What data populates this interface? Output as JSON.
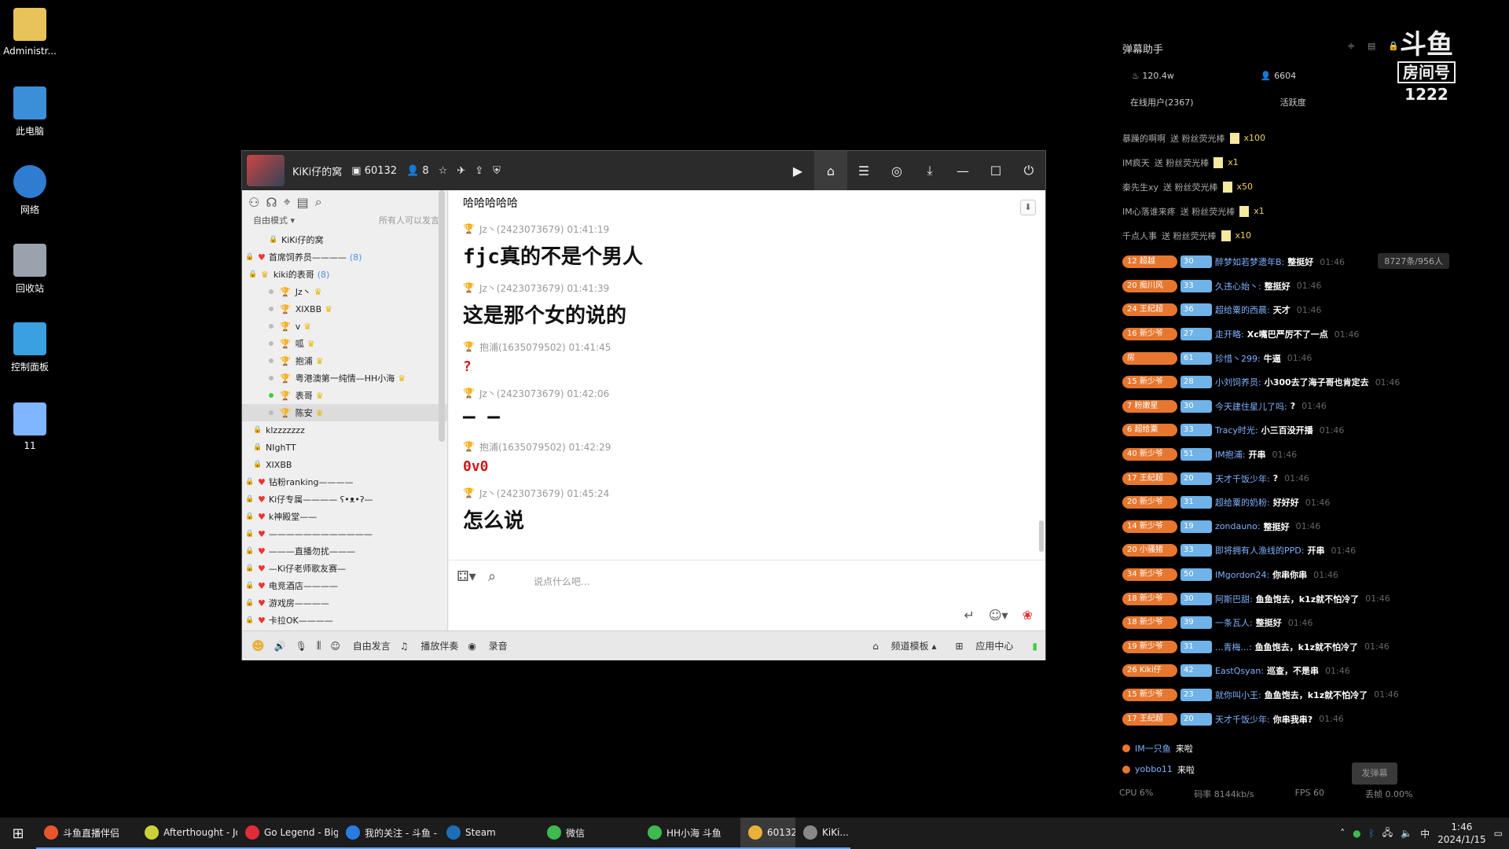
{
  "desktop": {
    "icons": [
      {
        "label": "Administr...",
        "color": "#e8c35a"
      },
      {
        "label": "此电脑",
        "color": "#3b8fd9"
      },
      {
        "label": "网络",
        "color": "#2f7dd1"
      },
      {
        "label": "回收站",
        "color": "#9aa3ad"
      },
      {
        "label": "控制面板",
        "color": "#3aa0e0"
      },
      {
        "label": "11",
        "color": "#7fb6ff"
      }
    ]
  },
  "window": {
    "title": "KiKi仔的窝",
    "channel_id": "60132",
    "members": "8",
    "left": {
      "mode": "自由模式",
      "mode_hint": "所有人可以发言",
      "tree": [
        {
          "label": "KiKi仔的窝",
          "type": "root"
        },
        {
          "label": "首席饲养员————",
          "type": "group",
          "count": "(8)"
        },
        {
          "label": "kiki的表哥",
          "type": "subgroup",
          "count": "(8)"
        },
        {
          "label": "Jz丶",
          "type": "user",
          "online": false
        },
        {
          "label": "XIXBB",
          "type": "user",
          "online": false
        },
        {
          "label": "v",
          "type": "user",
          "online": false
        },
        {
          "label": "呱",
          "type": "user",
          "online": false
        },
        {
          "label": "抱浦",
          "type": "user",
          "online": false
        },
        {
          "label": "粤港澳第一纯情—HH小海",
          "type": "user",
          "online": false
        },
        {
          "label": "表哥",
          "type": "user",
          "online": true
        },
        {
          "label": "陈安",
          "type": "user",
          "online": false,
          "selected": true
        },
        {
          "label": "klzzzzzzz",
          "type": "sub"
        },
        {
          "label": "NIghTT",
          "type": "sub"
        },
        {
          "label": "XIXBB",
          "type": "sub"
        },
        {
          "label": "钻粉ranking————",
          "type": "locked"
        },
        {
          "label": "Ki仔专属———— ʕ•ᴥ•ʔ—",
          "type": "locked"
        },
        {
          "label": "k神殿堂——",
          "type": "locked"
        },
        {
          "label": "————————————",
          "type": "locked"
        },
        {
          "label": "———直播勿扰———",
          "type": "locked"
        },
        {
          "label": "—Ki仔老师歌友赛—",
          "type": "locked"
        },
        {
          "label": "电竞酒店————",
          "type": "locked"
        },
        {
          "label": "游戏房————",
          "type": "locked"
        },
        {
          "label": "卡拉OK————",
          "type": "locked"
        }
      ]
    },
    "chat": {
      "messages": [
        {
          "header": "",
          "body": "哈哈哈哈哈",
          "style": "small"
        },
        {
          "header": "Jz丶(2423073679)  01:41:19",
          "body": "fjc真的不是个男人",
          "style": "big"
        },
        {
          "header": "Jz丶(2423073679)  01:41:39",
          "body": "这是那个女的说的",
          "style": "big"
        },
        {
          "header": "抱浦(1635079502)  01:41:45",
          "body": "?",
          "style": "red"
        },
        {
          "header": "Jz丶(2423073679)  01:42:06",
          "body": "— —",
          "style": "big"
        },
        {
          "header": "抱浦(1635079502)  01:42:29",
          "body": "0v0",
          "style": "red"
        },
        {
          "header": "Jz丶(2423073679)  01:45:24",
          "body": "怎么说",
          "style": "big"
        }
      ],
      "input_placeholder": "说点什么吧..."
    },
    "bottombar": {
      "free_speak": "自由发言",
      "play_accompany": "播放伴奏",
      "record": "录音",
      "template": "频道模板",
      "app_center": "应用中心"
    }
  },
  "danmu": {
    "title": "弹幕助手",
    "heat": "120.4w",
    "fans": "6604",
    "tab_online": "在线用户(2367)",
    "tab_active": "活跃度",
    "logo_top": "斗鱼",
    "logo_mid": "房间号",
    "room_number": "1222",
    "online_count": "8727条/956人",
    "gifts": [
      {
        "user": "暴躁的啊啊",
        "action": "送 粉丝荧光棒",
        "qty": "x100"
      },
      {
        "user": "IM疯天",
        "action": "送 粉丝荧光棒",
        "qty": "x1"
      },
      {
        "user": "秦先生xy",
        "action": "送 粉丝荧光棒",
        "qty": "x50"
      },
      {
        "user": "IM心落谁来疼",
        "action": "送 粉丝荧光棒",
        "qty": "x1"
      },
      {
        "user": "千点人事",
        "action": "送 粉丝荧光棒",
        "qty": "x10"
      }
    ],
    "messages": [
      {
        "lv": "12 超越",
        "fb": "30",
        "user": "醉梦如若梦遗年B:",
        "text": "整挺好",
        "time": "01:46"
      },
      {
        "lv": "20 痴川风",
        "fb": "33",
        "user": "久违心始丶:",
        "text": "整挺好",
        "time": "01:46"
      },
      {
        "lv": "24 王纪超",
        "fb": "36",
        "user": "超给粟的西晨:",
        "text": "天才",
        "time": "01:46"
      },
      {
        "lv": "16 新少爷",
        "fb": "27",
        "user": "走开略:",
        "text": "Xc嘴巴严厉不了一点",
        "time": "01:46"
      },
      {
        "lv": "房",
        "fb": "61",
        "user": "珍惜丶299:",
        "text": "牛逼",
        "time": "01:46"
      },
      {
        "lv": "15 新少爷",
        "fb": "28",
        "user": "小刘饲养员:",
        "text": "小300去了海子哥也肯定去",
        "time": "01:46"
      },
      {
        "lv": "7 粉嫩星",
        "fb": "30",
        "user": "今天建住星儿了吗:",
        "text": "?",
        "time": "01:46"
      },
      {
        "lv": "6 超给粟",
        "fb": "33",
        "user": "Tracy时光:",
        "text": "小三百没开播",
        "time": "01:46"
      },
      {
        "lv": "40 新少爷",
        "fb": "51",
        "user": "IM抱浦:",
        "text": "开串",
        "time": "01:46"
      },
      {
        "lv": "17 王纪超",
        "fb": "20",
        "user": "天才千饭少年:",
        "text": "?",
        "time": "01:46"
      },
      {
        "lv": "20 新少爷",
        "fb": "31",
        "user": "超给粟的奶粉:",
        "text": "好好好",
        "time": "01:46"
      },
      {
        "lv": "14 新少爷",
        "fb": "19",
        "user": "zondauno:",
        "text": "整挺好",
        "time": "01:46"
      },
      {
        "lv": "20 小骚猪",
        "fb": "33",
        "user": "即将拥有人渔线的PPD:",
        "text": "开串",
        "time": "01:46"
      },
      {
        "lv": "34 新少爷",
        "fb": "50",
        "user": "IMgordon24:",
        "text": "你串你串",
        "time": "01:46"
      },
      {
        "lv": "18 新少爷",
        "fb": "30",
        "user": "阿斯巴甜:",
        "text": "鱼鱼饱去，k1z就不怕冷了",
        "time": "01:46"
      },
      {
        "lv": "18 新少爷",
        "fb": "39",
        "user": "一条瓦人:",
        "text": "整挺好",
        "time": "01:46"
      },
      {
        "lv": "19 新少爷",
        "fb": "31",
        "user": "...青梅...:",
        "text": "鱼鱼饱去，k1z就不怕冷了",
        "time": "01:46"
      },
      {
        "lv": "26 Kiki仔",
        "fb": "42",
        "user": "EastQsyan:",
        "text": "巡查，不是串",
        "time": "01:46"
      },
      {
        "lv": "15 新少爷",
        "fb": "23",
        "user": "就你叫小王:",
        "text": "鱼鱼饱去，k1z就不怕冷了",
        "time": "01:46"
      },
      {
        "lv": "17 王纪超",
        "fb": "20",
        "user": "天才千饭少年:",
        "text": "你串我串?",
        "time": "01:46"
      }
    ],
    "enters": [
      {
        "user": "IM一只鱼",
        "text": "来啦"
      },
      {
        "user": "yobbo11",
        "text": "来啦"
      }
    ],
    "send_label": "发弹幕",
    "cpu": "CPU 6%",
    "bitrate": "码率 8144kb/s",
    "fps": "FPS 60",
    "drop": "丢帧 0.00%"
  },
  "taskbar": {
    "items": [
      {
        "label": "斗鱼直播伴侣",
        "color": "#e8552f"
      },
      {
        "label": "Afterthought - Joj...",
        "color": "#c9d23a"
      },
      {
        "label": "Go Legend - Big ...",
        "color": "#e22b3a"
      },
      {
        "label": "我的关注 - 斗鱼 - ...",
        "color": "#2a7de0"
      },
      {
        "label": "Steam",
        "color": "#1b6fb8"
      },
      {
        "label": "微信",
        "color": "#3fb950"
      },
      {
        "label": "HH小海 斗鱼",
        "color": "#3fb950"
      },
      {
        "label": "60132-",
        "color": "#e8b13a"
      },
      {
        "label": "KiKi...",
        "color": "#888"
      }
    ],
    "time": "1:46",
    "date": "2024/1/15",
    "ime": "中"
  }
}
